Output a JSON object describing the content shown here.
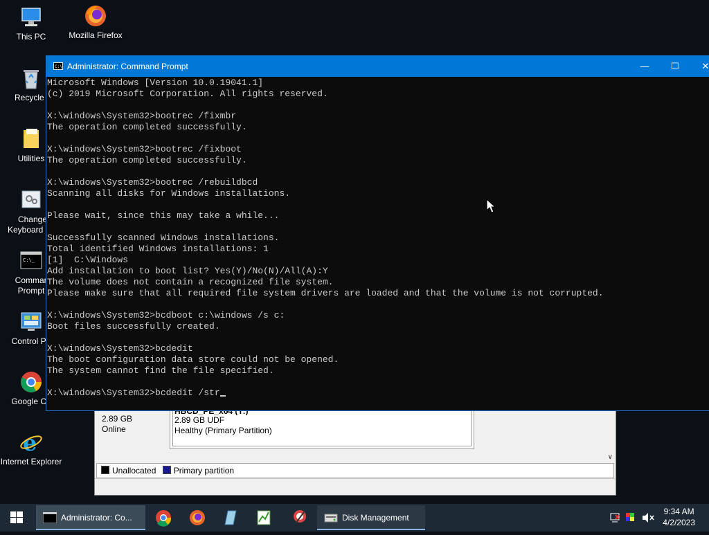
{
  "desktop": {
    "icons": [
      {
        "label": "This PC"
      },
      {
        "label": "Mozilla Firefox"
      },
      {
        "label": "Recycle B"
      },
      {
        "label": "Utilities"
      },
      {
        "label": "Change",
        "label2": "Keyboard La"
      },
      {
        "label": "Comman",
        "label2": "Prompt"
      },
      {
        "label": "Control Pa"
      },
      {
        "label": "Google Chr"
      },
      {
        "label": "Internet Explorer"
      }
    ]
  },
  "disk_management": {
    "disk_size": "2.89 GB",
    "disk_status": "Online",
    "partition_name": "HBCD_PE_x64  (Y:)",
    "partition_size": "2.89 GB UDF",
    "partition_status": "Healthy (Primary Partition)",
    "legend": [
      {
        "label": "Unallocated",
        "color": "#000000"
      },
      {
        "label": "Primary partition",
        "color": "#1a1a8c"
      }
    ]
  },
  "cmd_window": {
    "title": "Administrator: Command Prompt",
    "lines": [
      "Microsoft Windows [Version 10.0.19041.1]",
      "(c) 2019 Microsoft Corporation. All rights reserved.",
      "",
      "X:\\windows\\System32>bootrec /fixmbr",
      "The operation completed successfully.",
      "",
      "X:\\windows\\System32>bootrec /fixboot",
      "The operation completed successfully.",
      "",
      "X:\\windows\\System32>bootrec /rebuildbcd",
      "Scanning all disks for Windows installations.",
      "",
      "Please wait, since this may take a while...",
      "",
      "Successfully scanned Windows installations.",
      "Total identified Windows installations: 1",
      "[1]  C:\\Windows",
      "Add installation to boot list? Yes(Y)/No(N)/All(A):Y",
      "The volume does not contain a recognized file system.",
      "Please make sure that all required file system drivers are loaded and that the volume is not corrupted.",
      "",
      "X:\\windows\\System32>bcdboot c:\\windows /s c:",
      "Boot files successfully created.",
      "",
      "X:\\windows\\System32>bcdedit",
      "The boot configuration data store could not be opened.",
      "The system cannot find the file specified.",
      ""
    ],
    "current_input": "X:\\windows\\System32>bcdedit /str"
  },
  "taskbar": {
    "tasks": [
      {
        "label": "Administrator: Co..."
      },
      {
        "label": "Disk Management"
      }
    ],
    "clock": {
      "time": "9:34 AM",
      "date": "4/2/2023"
    }
  },
  "colors": {
    "titlebar": "#0078d7",
    "console_bg": "#0c0c0c",
    "console_text": "#cccccc",
    "taskbar": "#1d2a35"
  }
}
